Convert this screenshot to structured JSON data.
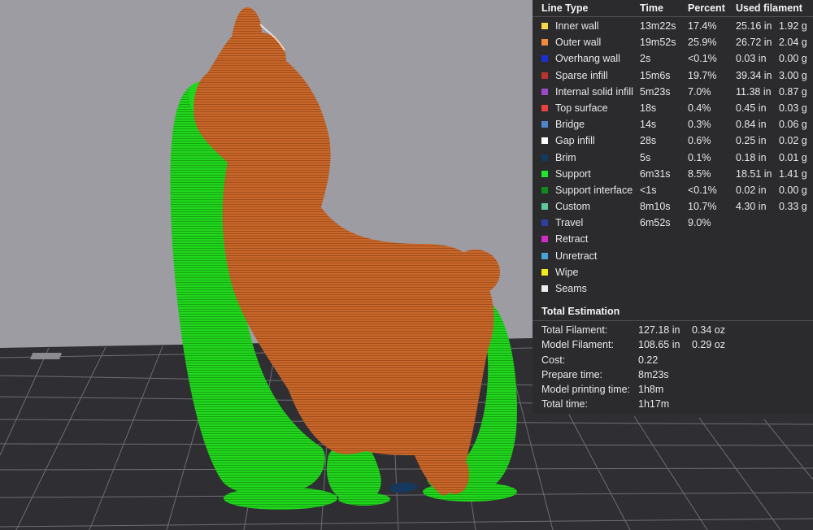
{
  "legend": {
    "headers": {
      "line_type": "Line Type",
      "time": "Time",
      "percent": "Percent",
      "used_filament": "Used filament"
    },
    "rows": [
      {
        "name": "Inner wall",
        "color": "#f5d64e",
        "time": "13m22s",
        "percent": "17.4%",
        "length": "25.16 in",
        "weight": "1.92 g"
      },
      {
        "name": "Outer wall",
        "color": "#f08a3c",
        "time": "19m52s",
        "percent": "25.9%",
        "length": "26.72 in",
        "weight": "2.04 g"
      },
      {
        "name": "Overhang wall",
        "color": "#1a2fd6",
        "time": "2s",
        "percent": "<0.1%",
        "length": "0.03 in",
        "weight": "0.00 g"
      },
      {
        "name": "Sparse infill",
        "color": "#b8342f",
        "time": "15m6s",
        "percent": "19.7%",
        "length": "39.34 in",
        "weight": "3.00 g"
      },
      {
        "name": "Internal solid infill",
        "color": "#9b49c4",
        "time": "5m23s",
        "percent": "7.0%",
        "length": "11.38 in",
        "weight": "0.87 g"
      },
      {
        "name": "Top surface",
        "color": "#e8413f",
        "time": "18s",
        "percent": "0.4%",
        "length": "0.45 in",
        "weight": "0.03 g"
      },
      {
        "name": "Bridge",
        "color": "#4f86c6",
        "time": "14s",
        "percent": "0.3%",
        "length": "0.84 in",
        "weight": "0.06 g"
      },
      {
        "name": "Gap infill",
        "color": "#ffffff",
        "time": "28s",
        "percent": "0.6%",
        "length": "0.25 in",
        "weight": "0.02 g"
      },
      {
        "name": "Brim",
        "color": "#0f3b63",
        "time": "5s",
        "percent": "0.1%",
        "length": "0.18 in",
        "weight": "0.01 g"
      },
      {
        "name": "Support",
        "color": "#20e52a",
        "time": "6m31s",
        "percent": "8.5%",
        "length": "18.51 in",
        "weight": "1.41 g"
      },
      {
        "name": "Support interface",
        "color": "#118a1e",
        "time": "<1s",
        "percent": "<0.1%",
        "length": "0.02 in",
        "weight": "0.00 g"
      },
      {
        "name": "Custom",
        "color": "#5fc99a",
        "time": "8m10s",
        "percent": "10.7%",
        "length": "4.30 in",
        "weight": "0.33 g"
      },
      {
        "name": "Travel",
        "color": "#2f3fa0",
        "time": "6m52s",
        "percent": "9.0%",
        "length": "",
        "weight": ""
      },
      {
        "name": "Retract",
        "color": "#d22cc8",
        "time": "",
        "percent": "",
        "length": "",
        "weight": ""
      },
      {
        "name": "Unretract",
        "color": "#4aa3d4",
        "time": "",
        "percent": "",
        "length": "",
        "weight": ""
      },
      {
        "name": "Wipe",
        "color": "#f2ea1a",
        "time": "",
        "percent": "",
        "length": "",
        "weight": ""
      },
      {
        "name": "Seams",
        "color": "#eeeeee",
        "time": "",
        "percent": "",
        "length": "",
        "weight": ""
      }
    ]
  },
  "total_estimation": {
    "title": "Total Estimation",
    "rows": [
      {
        "label": "Total Filament:",
        "value": "127.18 in",
        "value2": "0.34 oz"
      },
      {
        "label": "Model Filament:",
        "value": "108.65 in",
        "value2": "0.29 oz"
      },
      {
        "label": "Cost:",
        "value": "0.22",
        "value2": ""
      },
      {
        "label": "Prepare time:",
        "value": "8m23s",
        "value2": ""
      },
      {
        "label": "Model printing time:",
        "value": "1h8m",
        "value2": ""
      },
      {
        "label": "Total time:",
        "value": "1h17m",
        "value2": ""
      }
    ]
  },
  "scene": {
    "background_color": "#9a9aa0",
    "bed_color": "#2d2d30",
    "model_color": "#c8672a",
    "support_color": "#1fd21c"
  }
}
